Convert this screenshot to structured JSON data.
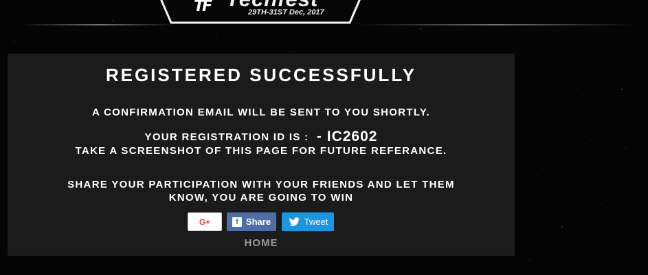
{
  "header": {
    "logo_mark": "TF",
    "logo_text": "Techfest",
    "logo_dates": "29TH-31ST Dec, 2017"
  },
  "registration": {
    "title": "REGISTERED SUCCESSFULLY",
    "confirmation_text": "A CONFIRMATION EMAIL WILL BE SENT TO YOU SHORTLY.",
    "id_prefix": "YOUR REGISTRATION ID IS :",
    "id_value": "- IC2602",
    "screenshot_text": "TAKE A SCREENSHOT OF THIS PAGE FOR FUTURE REFERANCE.",
    "share_text_line1": "SHARE YOUR PARTICIPATION WITH YOUR FRIENDS AND LET THEM",
    "share_text_line2": "KNOW, YOU ARE GOING TO WIN"
  },
  "social": {
    "google_plus": "G+",
    "facebook": "Share",
    "twitter": "Tweet"
  },
  "nav": {
    "home": "HOME"
  },
  "colors": {
    "background": "#050505",
    "card": "#1b1b1b",
    "facebook": "#4f6ea5",
    "twitter": "#1b95e0",
    "home": "#9a9a9a"
  },
  "icons": {
    "facebook": "facebook-icon",
    "twitter": "twitter-icon",
    "google_plus": "google-plus-icon"
  }
}
